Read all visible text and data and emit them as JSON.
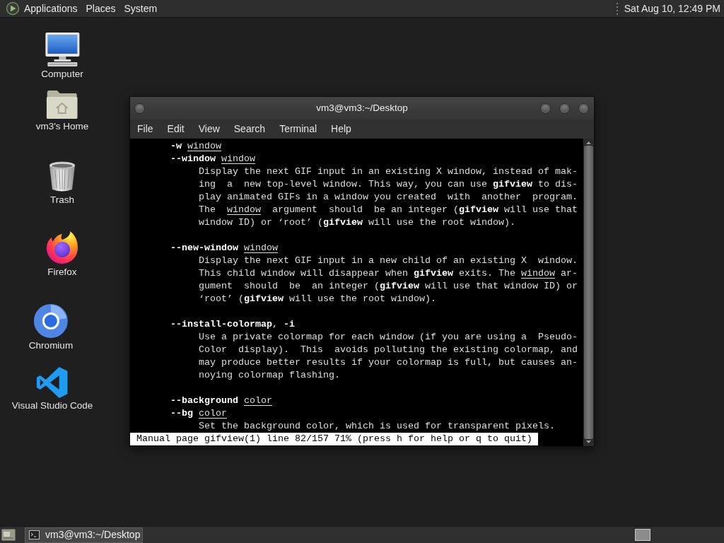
{
  "top_panel": {
    "menus": [
      "Applications",
      "Places",
      "System"
    ],
    "clock": "Sat Aug 10, 12:49 PM"
  },
  "desktop_icons": [
    {
      "kind": "computer",
      "label": "Computer"
    },
    {
      "kind": "home",
      "label": "vm3's Home"
    },
    {
      "kind": "trash",
      "label": "Trash"
    },
    {
      "kind": "firefox",
      "label": "Firefox"
    },
    {
      "kind": "chromium",
      "label": "Chromium"
    },
    {
      "kind": "vscode",
      "label": "Visual Studio Code"
    }
  ],
  "terminal": {
    "title": "vm3@vm3:~/Desktop",
    "menu": [
      "File",
      "Edit",
      "View",
      "Search",
      "Terminal",
      "Help"
    ],
    "sections": [
      {
        "options": [
          "**-w** *window*",
          "**--window** *window*"
        ],
        "lines": [
          "Display the next GIF input in an existing X window, instead of mak-",
          "ing  a  new top-level window. This way, you can use **gifview** to dis-",
          "play animated GIFs in a window you created  with  another  program.",
          "The  *window*  argument  should  be an integer (**gifview** will use that",
          "window ID) or ‘root’ (**gifview** will use the root window)."
        ]
      },
      {
        "options": [
          "**--new-window** *window*"
        ],
        "lines": [
          "Display the next GIF input in a new child of an existing X  window.",
          "This child window will disappear when **gifview** exits. The *window* ar-",
          "gument  should  be  an integer (**gifview** will use that window ID) or",
          "‘root’ (**gifview** will use the root window)."
        ]
      },
      {
        "options": [
          "**--install-colormap**, **-i**"
        ],
        "lines": [
          "Use a private colormap for each window (if you are using a  Pseudo-",
          "Color  display).  This  avoids polluting the existing colormap, and",
          "may produce better results if your colormap is full, but causes an-",
          "noying colormap flashing."
        ]
      },
      {
        "options": [
          "**--background** *color*",
          "**--bg** *color*"
        ],
        "lines": [
          "Set the background color, which is used for transparent pixels."
        ]
      }
    ],
    "status": "Manual page gifview(1) line 82/157 71% (press h for help or q to quit)"
  },
  "bottom_panel": {
    "tasks": [
      {
        "label": "vm3@vm3:~/Desktop",
        "selected": true
      }
    ]
  }
}
